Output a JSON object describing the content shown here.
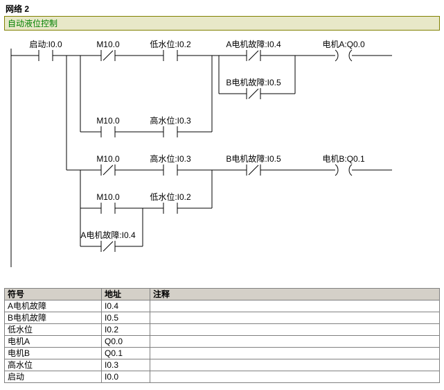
{
  "network": {
    "title": "网络 2",
    "description": "自动液位控制"
  },
  "labels": {
    "r1c1": "启动:I0.0",
    "r1c2": "M10.0",
    "r1c3": "低水位:I0.2",
    "r1c4": "A电机故障:I0.4",
    "r1o": "电机A:Q0.0",
    "r2c4": "B电机故障:I0.5",
    "r3c2": "M10.0",
    "r3c3": "高水位:I0.3",
    "r4c2": "M10.0",
    "r4c3": "高水位:I0.3",
    "r4c4": "B电机故障:I0.5",
    "r4o": "电机B:Q0.1",
    "r5c2": "M10.0",
    "r5c3": "低水位:I0.2",
    "r6c4": "A电机故障:I0.4"
  },
  "table": {
    "headers": {
      "symbol": "符号",
      "address": "地址",
      "comment": "注释"
    },
    "rows": [
      {
        "symbol": "A电机故障",
        "address": "I0.4",
        "comment": ""
      },
      {
        "symbol": "B电机故障",
        "address": "I0.5",
        "comment": ""
      },
      {
        "symbol": "低水位",
        "address": "I0.2",
        "comment": ""
      },
      {
        "symbol": "电机A",
        "address": "Q0.0",
        "comment": ""
      },
      {
        "symbol": "电机B",
        "address": "Q0.1",
        "comment": ""
      },
      {
        "symbol": "高水位",
        "address": "I0.3",
        "comment": ""
      },
      {
        "symbol": "启动",
        "address": "I0.0",
        "comment": ""
      }
    ]
  }
}
